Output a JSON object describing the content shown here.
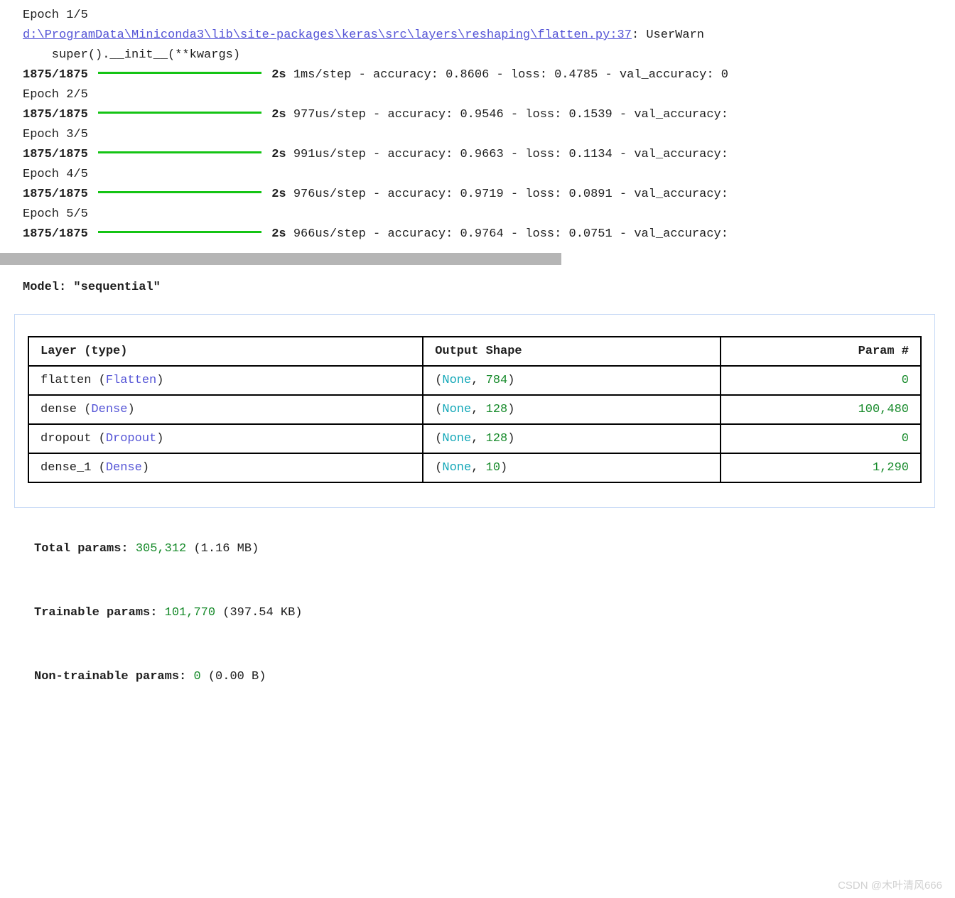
{
  "training": {
    "epoch1_label": "Epoch 1/5",
    "warning_path": "d:\\ProgramData\\Miniconda3\\lib\\site-packages\\keras\\src\\layers\\reshaping\\flatten.py:37",
    "warning_suffix": ": UserWarn",
    "super_line": "    super().__init__(**kwargs)",
    "steps": "1875/1875",
    "time": "2s",
    "epoch1_metrics": " 1ms/step - accuracy: 0.8606 - loss: 0.4785 - val_accuracy: 0",
    "epoch2_label": "Epoch 2/5",
    "epoch2_metrics": " 977us/step - accuracy: 0.9546 - loss: 0.1539 - val_accuracy:",
    "epoch3_label": "Epoch 3/5",
    "epoch3_metrics": " 991us/step - accuracy: 0.9663 - loss: 0.1134 - val_accuracy:",
    "epoch4_label": "Epoch 4/5",
    "epoch4_metrics": " 976us/step - accuracy: 0.9719 - loss: 0.0891 - val_accuracy:",
    "epoch5_label": "Epoch 5/5",
    "epoch5_metrics": " 966us/step - accuracy: 0.9764 - loss: 0.0751 - val_accuracy:"
  },
  "model": {
    "title": "Model: \"sequential\""
  },
  "table": {
    "headers": {
      "layer": "Layer (type)",
      "shape": "Output Shape",
      "params": "Param #"
    },
    "rows": [
      {
        "name": "flatten ",
        "type": "Flatten",
        "none": "None",
        "dim": "784",
        "params": "0"
      },
      {
        "name": "dense ",
        "type": "Dense",
        "none": "None",
        "dim": "128",
        "params": "100,480"
      },
      {
        "name": "dropout ",
        "type": "Dropout",
        "none": "None",
        "dim": "128",
        "params": "0"
      },
      {
        "name": "dense_1 ",
        "type": "Dense",
        "none": "None",
        "dim": "10",
        "params": "1,290"
      }
    ]
  },
  "params": {
    "total_label": "Total params: ",
    "total_value": "305,312",
    "total_size": " (1.16 MB)",
    "trainable_label": "Trainable params: ",
    "trainable_value": "101,770",
    "trainable_size": " (397.54 KB)",
    "nontrainable_label": "Non-trainable params: ",
    "nontrainable_value": "0",
    "nontrainable_size": " (0.00 B)"
  },
  "watermark": "CSDN @木叶清风666"
}
